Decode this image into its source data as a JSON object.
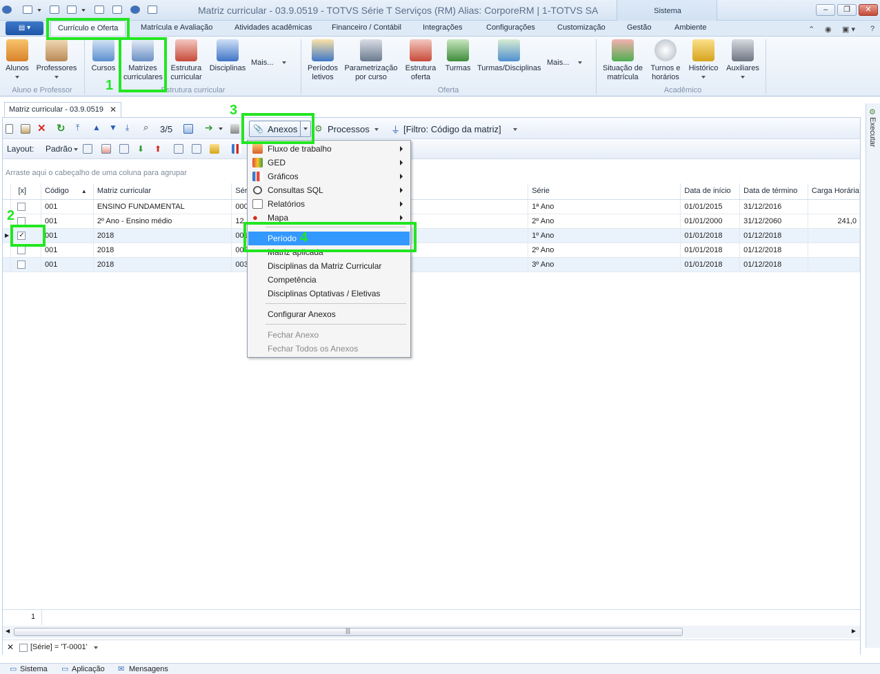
{
  "window": {
    "title": "Matriz curricular - 03.9.0519 - TOTVS Série T Serviços (RM) Alias: CorporeRM | 1-TOTVS SA",
    "context_tab": "Sistema"
  },
  "tabs": [
    "Currículo e Oferta",
    "Matrícula e Avaliação",
    "Atividades acadêmicas",
    "Financeiro / Contábil",
    "Integrações",
    "Configurações",
    "Customização",
    "Gestão",
    "Ambiente"
  ],
  "ribbon": {
    "buttons": [
      "Alunos",
      "Professores",
      "Cursos",
      "Matrizes curriculares",
      "Estrutura curricular",
      "Disciplinas",
      "Mais...",
      "Períodos letivos",
      "Parametrização por curso",
      "Estrutura oferta",
      "Turmas",
      "Turmas/Disciplinas",
      "Mais...",
      "Situação de matrícula",
      "Turnos e horários",
      "Histórico",
      "Auxiliares"
    ],
    "groups": [
      "Aluno e Professor",
      "Estrutura curricular",
      "Oferta",
      "Acadêmico"
    ]
  },
  "doc_tab": "Matriz curricular - 03.9.0519",
  "toolbar": {
    "record_nav": "3/5",
    "anexos": "Anexos",
    "processos": "Processos",
    "filtro": "[Filtro: Código da matriz]",
    "layout": "Layout:",
    "padrao": "Padrão"
  },
  "group_hint": "Arraste aqui o cabeçalho de uma coluna para agrupar",
  "grid": {
    "columns": [
      "[x]",
      "Código",
      "Matriz curricular",
      "Séri",
      "Série",
      "Data de início",
      "Data de término",
      "Carga Horária"
    ],
    "rows": [
      {
        "checked": "",
        "codigo": "001",
        "matriz": "ENSINO FUNDAMENTAL",
        "seri": "000",
        "serie": "1ª Ano",
        "inicio": "01/01/2015",
        "termino": "31/12/2016",
        "carga": ""
      },
      {
        "checked": "",
        "codigo": "001",
        "matriz": "2º Ano - Ensino médio",
        "seri": "12",
        "serie": "2º Ano",
        "inicio": "01/01/2000",
        "termino": "31/12/2060",
        "carga": "241,0"
      },
      {
        "checked": "✓",
        "codigo": "001",
        "matriz": "2018",
        "seri": "001",
        "serie": "1º Ano",
        "inicio": "01/01/2018",
        "termino": "01/12/2018",
        "carga": ""
      },
      {
        "checked": "",
        "codigo": "001",
        "matriz": "2018",
        "seri": "002",
        "serie": "2º Ano",
        "inicio": "01/01/2018",
        "termino": "01/12/2018",
        "carga": ""
      },
      {
        "checked": "",
        "codigo": "001",
        "matriz": "2018",
        "seri": "003",
        "serie": "3º Ano",
        "inicio": "01/01/2018",
        "termino": "01/12/2018",
        "carga": ""
      }
    ]
  },
  "footer_count": "1",
  "filter_expr": "[Série] = 'T-0001'",
  "status": {
    "sistema": "Sistema",
    "aplicacao": "Aplicação",
    "mensagens": "Mensagens"
  },
  "side_panel": "Executar",
  "menu": {
    "items": [
      "Fluxo de trabalho",
      "GED",
      "Gráficos",
      "Consultas SQL",
      "Relatórios",
      "Mapa",
      "Período",
      "Matriz aplicada",
      "Disciplinas da Matriz Curricular",
      "Competência",
      "Disciplinas Optativas / Eletivas",
      "Configurar Anexos",
      "Fechar Anexo",
      "Fechar Todos os Anexos"
    ]
  },
  "annotations": [
    "1",
    "2",
    "3",
    "4"
  ],
  "colors": {
    "highlight": "#22e622",
    "selection": "#3399ff"
  }
}
